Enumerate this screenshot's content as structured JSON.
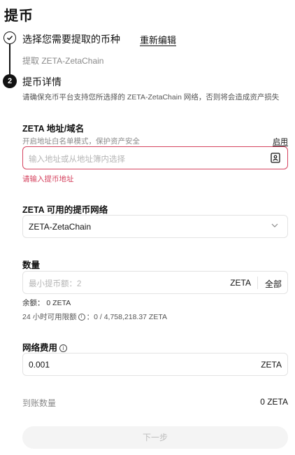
{
  "page": {
    "title": "提币"
  },
  "step1": {
    "title": "选择您需要提取的币种",
    "edit_label": "重新编辑",
    "subtitle": "提取 ZETA-ZetaChain"
  },
  "step2": {
    "number": "2",
    "title": "提币详情",
    "description": "请确保充币平台支持您所选择的 ZETA-ZetaChain 网络，否则将会造成资产损失"
  },
  "address": {
    "label": "ZETA 地址/域名",
    "hint": "开启地址白名单模式，保护资产安全",
    "enable_label": "启用",
    "placeholder": "输入地址或从地址簿内选择",
    "error": "请输入提币地址"
  },
  "network": {
    "label": "ZETA 可用的提币网络",
    "selected": "ZETA-ZetaChain"
  },
  "amount": {
    "label": "数量",
    "placeholder": "最小提币额：2",
    "unit": "ZETA",
    "all_label": "全部",
    "balance": "余额： 0 ZETA",
    "limit_prefix": "24 小时可用限额",
    "limit_value": "：0 / 4,758,218.37 ZETA"
  },
  "fee": {
    "label": "网络费用",
    "value": "0.001",
    "unit": "ZETA"
  },
  "received": {
    "label": "到账数量",
    "value": "0 ZETA"
  },
  "next_button": {
    "label": "下一步"
  },
  "colors": {
    "error": "#d5435f",
    "text": "#121212",
    "muted": "#8a8a8a"
  }
}
